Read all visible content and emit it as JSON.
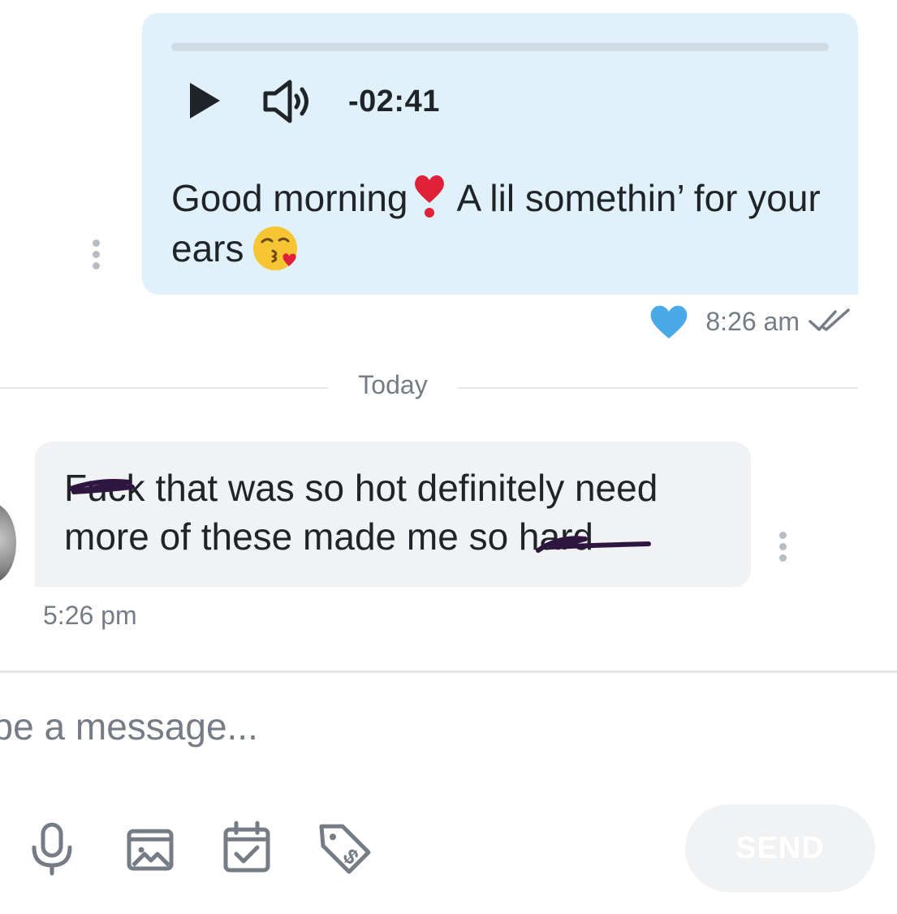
{
  "outgoing_message": {
    "audio": {
      "time_remaining": "-02:41",
      "progress": 0
    },
    "text_part1": "Good morning",
    "text_part2": "A lil somethin’ for your ears",
    "emoji_1": "heavy-heart-exclamation",
    "emoji_2": "face-throwing-a-kiss",
    "time": "8:26 am",
    "liked": true,
    "status": "read"
  },
  "day_divider": {
    "label": "Today"
  },
  "incoming_message": {
    "text": "Fuck that was so hot definitely need more of these made me so hard",
    "time": "5:26 pm"
  },
  "composer": {
    "placeholder": "Type a message...",
    "send_label": "SEND",
    "tools": [
      "microphone-icon",
      "gallery-icon",
      "calendar-icon",
      "price-tag-icon"
    ]
  },
  "colors": {
    "outgoing_bubble": "#e1f1fa",
    "incoming_bubble": "#f1f2f4",
    "like_heart": "#4aaae8",
    "muted_text": "#757c85",
    "scribble": "#2e1640"
  }
}
